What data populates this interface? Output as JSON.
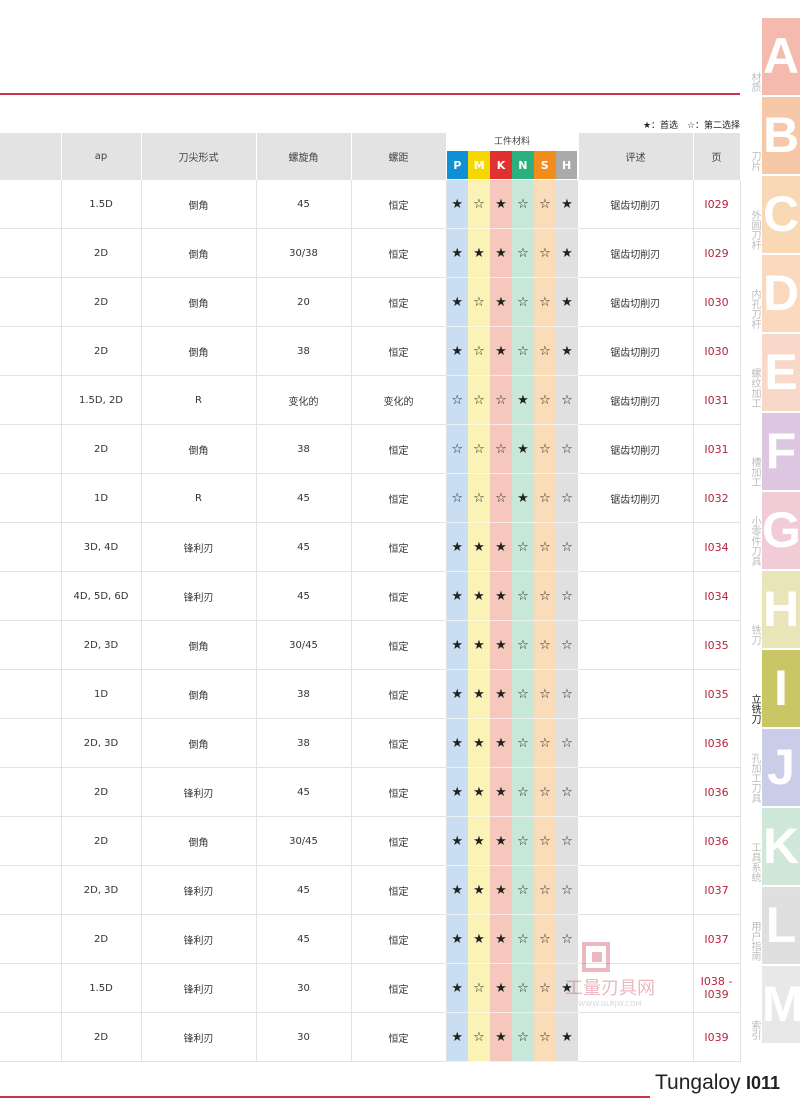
{
  "legend": {
    "primary": "★：首选",
    "secondary": "☆：第二选择"
  },
  "headers": {
    "ap": "ap",
    "corner": "刀尖形式",
    "helix": "螺旋角",
    "pitch": "螺距",
    "material_group": "工件材料",
    "remark": "评述",
    "page": "页"
  },
  "materials": [
    {
      "letter": "P",
      "color": "#0e8fd6",
      "light": "#c9def3"
    },
    {
      "letter": "M",
      "color": "#f5d800",
      "light": "#fbf3b6"
    },
    {
      "letter": "K",
      "color": "#e03030",
      "light": "#f6c8bd"
    },
    {
      "letter": "N",
      "color": "#2cb080",
      "light": "#c7e8d9"
    },
    {
      "letter": "S",
      "color": "#f28c1a",
      "light": "#fbdcb8"
    },
    {
      "letter": "H",
      "color": "#aaaaaa",
      "light": "#e0e0e0"
    }
  ],
  "rows": [
    {
      "ap": "1.5D",
      "corner": "倒角",
      "helix": "45",
      "pitch": "恒定",
      "m": [
        "★",
        "☆",
        "★",
        "☆",
        "☆",
        "★"
      ],
      "remark": "锯齿切削刃",
      "page": "I029"
    },
    {
      "ap": "2D",
      "corner": "倒角",
      "helix": "30/38",
      "pitch": "恒定",
      "m": [
        "★",
        "★",
        "★",
        "☆",
        "☆",
        "★"
      ],
      "remark": "锯齿切削刃",
      "page": "I029"
    },
    {
      "ap": "2D",
      "corner": "倒角",
      "helix": "20",
      "pitch": "恒定",
      "m": [
        "★",
        "☆",
        "★",
        "☆",
        "☆",
        "★"
      ],
      "remark": "锯齿切削刃",
      "page": "I030"
    },
    {
      "ap": "2D",
      "corner": "倒角",
      "helix": "38",
      "pitch": "恒定",
      "m": [
        "★",
        "☆",
        "★",
        "☆",
        "☆",
        "★"
      ],
      "remark": "锯齿切削刃",
      "page": "I030"
    },
    {
      "ap": "1.5D, 2D",
      "corner": "R",
      "helix": "变化的",
      "pitch": "变化的",
      "m": [
        "☆",
        "☆",
        "☆",
        "★",
        "☆",
        "☆"
      ],
      "remark": "锯齿切削刃",
      "page": "I031"
    },
    {
      "ap": "2D",
      "corner": "倒角",
      "helix": "38",
      "pitch": "恒定",
      "m": [
        "☆",
        "☆",
        "☆",
        "★",
        "☆",
        "☆"
      ],
      "remark": "锯齿切削刃",
      "page": "I031"
    },
    {
      "ap": "1D",
      "corner": "R",
      "helix": "45",
      "pitch": "恒定",
      "m": [
        "☆",
        "☆",
        "☆",
        "★",
        "☆",
        "☆"
      ],
      "remark": "锯齿切削刃",
      "page": "I032"
    },
    {
      "ap": "3D, 4D",
      "corner": "锋利刃",
      "helix": "45",
      "pitch": "恒定",
      "m": [
        "★",
        "★",
        "★",
        "☆",
        "☆",
        "☆"
      ],
      "remark": "",
      "page": "I034"
    },
    {
      "ap": "4D, 5D, 6D",
      "corner": "锋利刃",
      "helix": "45",
      "pitch": "恒定",
      "m": [
        "★",
        "★",
        "★",
        "☆",
        "☆",
        "☆"
      ],
      "remark": "",
      "page": "I034"
    },
    {
      "ap": "2D, 3D",
      "corner": "倒角",
      "helix": "30/45",
      "pitch": "恒定",
      "m": [
        "★",
        "★",
        "★",
        "☆",
        "☆",
        "☆"
      ],
      "remark": "",
      "page": "I035"
    },
    {
      "ap": "1D",
      "corner": "倒角",
      "helix": "38",
      "pitch": "恒定",
      "m": [
        "★",
        "★",
        "★",
        "☆",
        "☆",
        "☆"
      ],
      "remark": "",
      "page": "I035"
    },
    {
      "ap": "2D, 3D",
      "corner": "倒角",
      "helix": "38",
      "pitch": "恒定",
      "m": [
        "★",
        "★",
        "★",
        "☆",
        "☆",
        "☆"
      ],
      "remark": "",
      "page": "I036"
    },
    {
      "ap": "2D",
      "corner": "锋利刃",
      "helix": "45",
      "pitch": "恒定",
      "m": [
        "★",
        "★",
        "★",
        "☆",
        "☆",
        "☆"
      ],
      "remark": "",
      "page": "I036"
    },
    {
      "ap": "2D",
      "corner": "倒角",
      "helix": "30/45",
      "pitch": "恒定",
      "m": [
        "★",
        "★",
        "★",
        "☆",
        "☆",
        "☆"
      ],
      "remark": "",
      "page": "I036"
    },
    {
      "ap": "2D, 3D",
      "corner": "锋利刃",
      "helix": "45",
      "pitch": "恒定",
      "m": [
        "★",
        "★",
        "★",
        "☆",
        "☆",
        "☆"
      ],
      "remark": "",
      "page": "I037"
    },
    {
      "ap": "2D",
      "corner": "锋利刃",
      "helix": "45",
      "pitch": "恒定",
      "m": [
        "★",
        "★",
        "★",
        "☆",
        "☆",
        "☆"
      ],
      "remark": "",
      "page": "I037"
    },
    {
      "ap": "1.5D",
      "corner": "锋利刃",
      "helix": "30",
      "pitch": "恒定",
      "m": [
        "★",
        "☆",
        "★",
        "☆",
        "☆",
        "★"
      ],
      "remark": "",
      "page": "I038 -\nI039"
    },
    {
      "ap": "2D",
      "corner": "锋利刃",
      "helix": "30",
      "pitch": "恒定",
      "m": [
        "★",
        "☆",
        "★",
        "☆",
        "☆",
        "★"
      ],
      "remark": "",
      "page": "I039"
    }
  ],
  "tabs": [
    {
      "letter": "A",
      "label": "材质",
      "color": "#f4b7a9"
    },
    {
      "letter": "B",
      "label": "刀片",
      "color": "#f7c6a4"
    },
    {
      "letter": "C",
      "label": "外圆刀杆",
      "color": "#f9d6b2"
    },
    {
      "letter": "D",
      "label": "内孔刀杆",
      "color": "#fad8bc"
    },
    {
      "letter": "E",
      "label": "螺纹加工",
      "color": "#fad6c7"
    },
    {
      "letter": "F",
      "label": "槽加工",
      "color": "#dcc3e1"
    },
    {
      "letter": "G",
      "label": "小零件刀具",
      "color": "#f1c9d3"
    },
    {
      "letter": "H",
      "label": "铣刀",
      "color": "#e9e4b5"
    },
    {
      "letter": "I",
      "label": "立铣刀",
      "color": "#c7c35e",
      "active": true
    },
    {
      "letter": "J",
      "label": "孔加工刀具",
      "color": "#c7cbe6"
    },
    {
      "letter": "K",
      "label": "工具系统",
      "color": "#cde7d8"
    },
    {
      "letter": "L",
      "label": "用户指南",
      "color": "#dedede"
    },
    {
      "letter": "M",
      "label": "索引",
      "color": "#e7e7e7"
    }
  ],
  "footer": {
    "brand": "Tungaloy",
    "page_no": "I011"
  },
  "watermark": {
    "text": "工量刃具网",
    "url": "WWW.GLRJW.COM"
  }
}
